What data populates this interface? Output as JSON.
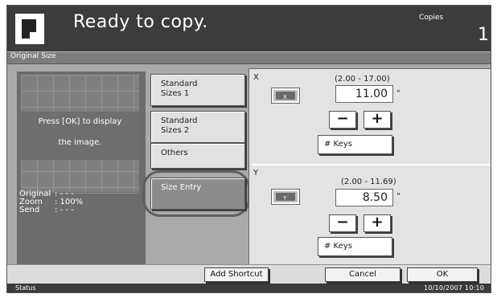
{
  "header": {
    "title": "Ready to copy.",
    "copies_label": "Copies",
    "copies_value": "1",
    "doc_icon": "document-icon"
  },
  "subtitle": "Original Size",
  "preview": {
    "message_line1": "Press [OK] to display",
    "message_line2": "the image.",
    "info": [
      {
        "label": "Original",
        "value": ":  - - -"
      },
      {
        "label": "Zoom",
        "value": ":  100%"
      },
      {
        "label": "Send",
        "value": ":  - - -"
      }
    ]
  },
  "size_buttons": {
    "standard1": [
      "Standard",
      "Sizes 1"
    ],
    "standard2": [
      "Standard",
      "Sizes 2"
    ],
    "others": "Others",
    "size_entry": "Size Entry"
  },
  "x": {
    "axis": "X",
    "range": "(2.00 - 17.00)",
    "value": "11.00",
    "unit": "\"",
    "minus": "−",
    "plus": "+",
    "keys": "# Keys"
  },
  "y": {
    "axis": "Y",
    "range": "(2.00 - 11.69)",
    "value": "8.50",
    "unit": "\"",
    "minus": "−",
    "plus": "+",
    "keys": "# Keys"
  },
  "footer": {
    "add_shortcut": "Add Shortcut",
    "cancel": "Cancel",
    "ok": "OK"
  },
  "status": {
    "label": "Status",
    "datetime": "10/10/2007   10:10"
  }
}
